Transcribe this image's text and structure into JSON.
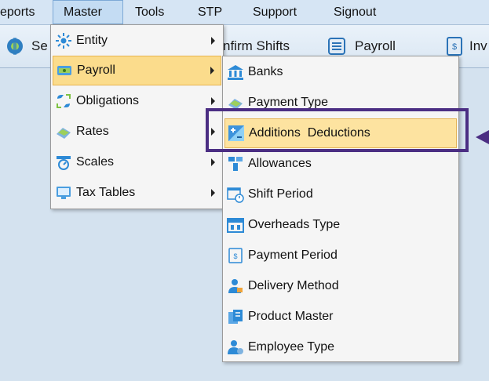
{
  "menubar": {
    "items": [
      {
        "label": "eports"
      },
      {
        "label": "Master"
      },
      {
        "label": "Tools"
      },
      {
        "label": "STP"
      },
      {
        "label": "Support"
      },
      {
        "label": "Signout"
      }
    ]
  },
  "toolbar": {
    "items": [
      {
        "label": "Se"
      },
      {
        "label": "nfirm Shifts"
      },
      {
        "label": "Payroll"
      },
      {
        "label": "Inv"
      }
    ]
  },
  "master_menu": {
    "items": [
      {
        "label": "Entity",
        "icon": "entity-icon"
      },
      {
        "label": "Payroll",
        "icon": "payroll-icon"
      },
      {
        "label": "Obligations",
        "icon": "obligations-icon"
      },
      {
        "label": "Rates",
        "icon": "rates-icon"
      },
      {
        "label": "Scales",
        "icon": "scales-icon"
      },
      {
        "label": "Tax Tables",
        "icon": "tax-tables-icon"
      }
    ]
  },
  "payroll_menu": {
    "items": [
      {
        "label": "Banks",
        "icon": "bank-icon"
      },
      {
        "label": "Payment Type",
        "icon": "payment-type-icon"
      },
      {
        "label": "Additions  Deductions",
        "icon": "plus-minus-icon"
      },
      {
        "label": "Allowances",
        "icon": "allowances-icon"
      },
      {
        "label": "Shift Period",
        "icon": "calendar-clock-icon"
      },
      {
        "label": "Overheads Type",
        "icon": "overheads-icon"
      },
      {
        "label": "Payment Period",
        "icon": "payment-period-icon"
      },
      {
        "label": "Delivery Method",
        "icon": "delivery-icon"
      },
      {
        "label": "Product Master",
        "icon": "product-icon"
      },
      {
        "label": "Employee Type",
        "icon": "employee-icon"
      }
    ]
  },
  "colors": {
    "highlight": "#fbdc8c",
    "callout": "#4b2e83",
    "menubar_bg": "#d6e5f4",
    "workspace_bg": "#d4e2ef"
  }
}
